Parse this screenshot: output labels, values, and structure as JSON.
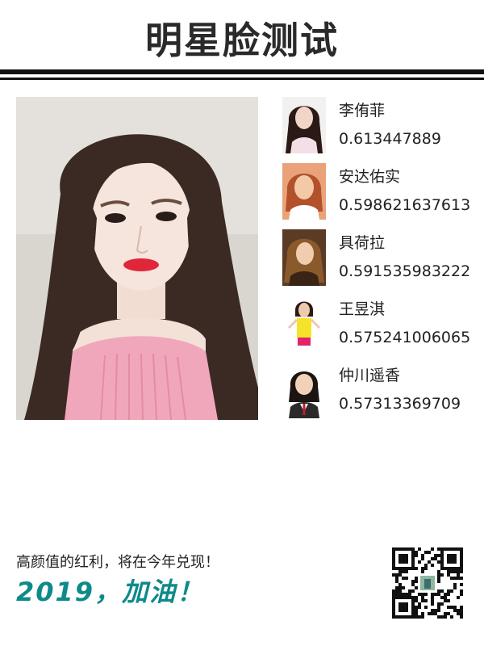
{
  "header": {
    "title": "明星脸测试"
  },
  "main_photo": {
    "description_icon": "user-photo"
  },
  "results": [
    {
      "name": "李侑菲",
      "score": "0.613447889",
      "skin": "#f1d6c8",
      "hair": "#2a1a16",
      "cloth": "#f4dfe6",
      "bg": "#f3f1ef"
    },
    {
      "name": "安达佑实",
      "score": "0.598621637613",
      "skin": "#f3c9a8",
      "hair": "#b2512a",
      "cloth": "#ffffff",
      "bg": "#e9a27a"
    },
    {
      "name": "具荷拉",
      "score": "0.591535983222",
      "skin": "#f1cdb0",
      "hair": "#8a5a2a",
      "cloth": "#3a2416",
      "bg": "#5b3a26"
    },
    {
      "name": "王昱淇",
      "score": "0.575241006065",
      "skin": "#f0c9ad",
      "hair": "#2a1b14",
      "cloth": "#f4e32a",
      "bg": "#ffffff"
    },
    {
      "name": "仲川遥香",
      "score": "0.57313369709",
      "skin": "#f2d1bb",
      "hair": "#1c1410",
      "cloth": "#ffffff",
      "bg": "#ffffff"
    }
  ],
  "footer": {
    "slogan": "高颜值的红利，将在今年兑现！",
    "motto": "2019，加油！"
  },
  "colors": {
    "accent": "#0f8a8a",
    "rule": "#111111"
  }
}
